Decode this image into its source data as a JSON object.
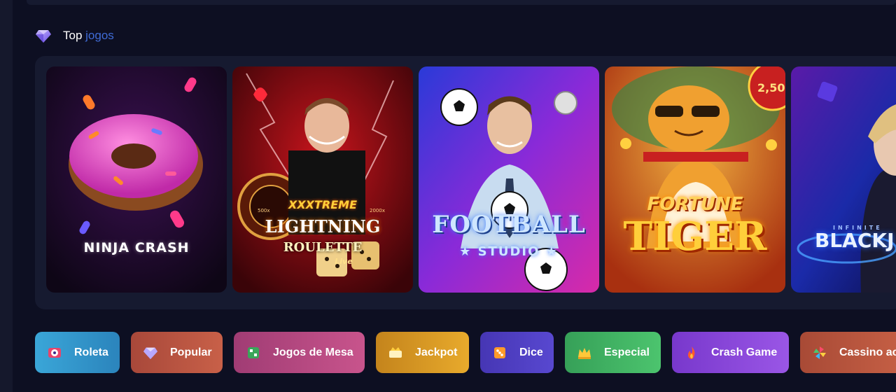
{
  "section": {
    "title_main": "Top",
    "title_accent": "jogos",
    "icon": "diamond-icon"
  },
  "games": [
    {
      "name": "ninja-crash",
      "title": "NINJA CRASH"
    },
    {
      "name": "xxxtreme-lightning-roulette",
      "line1": "XXXTREME",
      "line2": "LIGHTNING",
      "line3": "ROULETTE",
      "line4": "Live"
    },
    {
      "name": "football-studio",
      "line1": "FOOTBALL",
      "line2": "★ STUDIO ★"
    },
    {
      "name": "fortune-tiger",
      "line1": "FORTUNE",
      "line2": "TIGER"
    },
    {
      "name": "infinite-blackjack",
      "line1": "INFINITE",
      "line2": "BLACKJ"
    }
  ],
  "categories": [
    {
      "label": "Roleta",
      "icon": "roulette-icon",
      "color_from": "#3aa6d8",
      "color_to": "#2b7fb8"
    },
    {
      "label": "Popular",
      "icon": "diamond-icon",
      "color_from": "#b0503a",
      "color_to": "#c96048"
    },
    {
      "label": "Jogos de Mesa",
      "icon": "table-games-icon",
      "color_from": "#a83f78",
      "color_to": "#c9548e"
    },
    {
      "label": "Jackpot",
      "icon": "jackpot-icon",
      "color_from": "#c98a1e",
      "color_to": "#e6a82a"
    },
    {
      "label": "Dice",
      "icon": "dice-icon",
      "color_from": "#4a3ab8",
      "color_to": "#5a48d0"
    },
    {
      "label": "Especial",
      "icon": "crown-icon",
      "color_from": "#3aa65a",
      "color_to": "#4cc46e"
    },
    {
      "label": "Crash Game",
      "icon": "fire-icon",
      "color_from": "#7a3ad0",
      "color_to": "#9a56e6"
    },
    {
      "label": "Cassino ao vivo",
      "icon": "pinwheel-icon",
      "color_from": "#b0503a",
      "color_to": "#d06848"
    }
  ]
}
